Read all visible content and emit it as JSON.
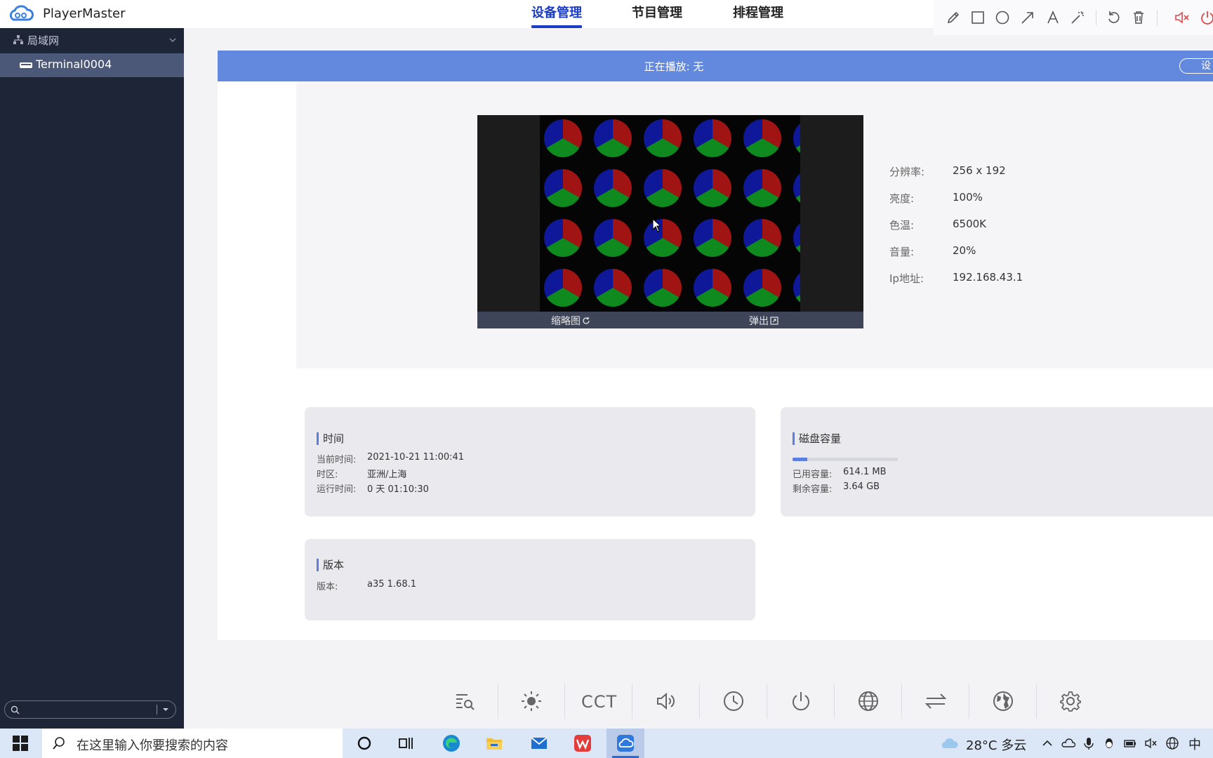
{
  "app": {
    "name": "PlayerMaster"
  },
  "nav": {
    "tabs": [
      {
        "label": "设备管理",
        "active": true
      },
      {
        "label": "节目管理"
      },
      {
        "label": "排程管理"
      }
    ]
  },
  "annotation_toolbar": {
    "tools": [
      "pencil-icon",
      "rectangle-icon",
      "circle-icon",
      "arrow-icon",
      "text-icon",
      "magic-wand-icon",
      "undo-icon",
      "trash-icon",
      "mute-icon"
    ]
  },
  "sidebar": {
    "group_label": "局域网",
    "items": [
      {
        "label": "Terminal0004",
        "selected": true
      }
    ],
    "search": {
      "value": "",
      "placeholder": ""
    }
  },
  "status": {
    "now_playing_label": "正在播放:",
    "now_playing_value": "无",
    "settings_button": "设"
  },
  "preview": {
    "thumbnail_label": "缩略图",
    "popout_label": "弹出"
  },
  "device_info": {
    "resolution_label": "分辨率:",
    "resolution": "256 x 192",
    "brightness_label": "亮度:",
    "brightness": "100%",
    "color_temp_label": "色温:",
    "color_temp": "6500K",
    "volume_label": "音量:",
    "volume": "20%",
    "ip_label": "Ip地址:",
    "ip": "192.168.43.1"
  },
  "time_card": {
    "title": "时间",
    "current_time_label": "当前时间:",
    "current_time": "2021-10-21 11:00:41",
    "timezone_label": "时区:",
    "timezone": "亚洲/上海",
    "uptime_label": "运行时间:",
    "uptime": "0 天 01:10:30"
  },
  "disk_card": {
    "title": "磁盘容量",
    "used_label": "已用容量:",
    "used": "614.1 MB",
    "free_label": "剩余容量:",
    "free": "3.64 GB",
    "used_fraction": 0.14
  },
  "version_card": {
    "title": "版本",
    "version_label": "版本:",
    "version": "a35 1.68.1"
  },
  "bottom_toolbar": {
    "cct_label": "CCT"
  },
  "taskbar": {
    "search_placeholder": "在这里输入你要搜索的内容",
    "weather": "28°C 多云",
    "ime": "中"
  },
  "colors": {
    "accent": "#1a3cc8",
    "status_bar": "#6289de",
    "sidebar": "#1e2537",
    "sidebar_selected": "#4b5877"
  }
}
